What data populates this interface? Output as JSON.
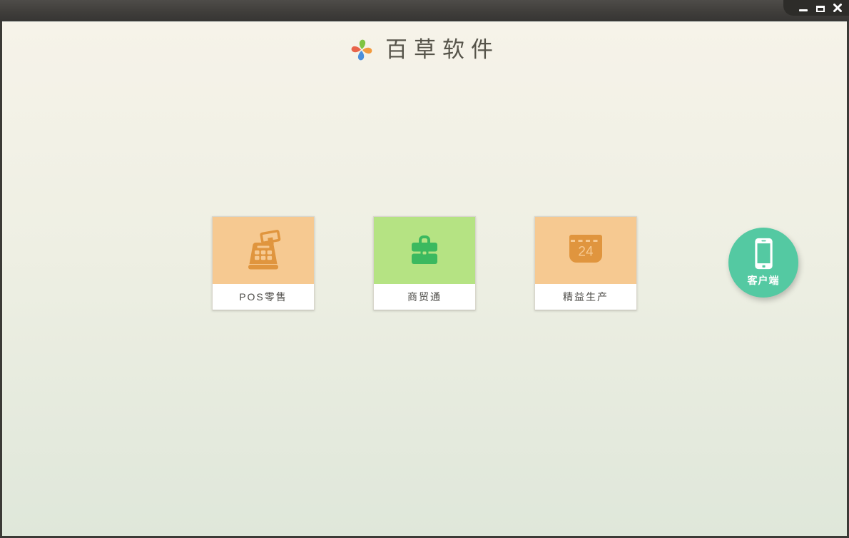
{
  "titlebar": {
    "controls": [
      {
        "name": "minimize"
      },
      {
        "name": "maximize"
      },
      {
        "name": "close"
      }
    ]
  },
  "header": {
    "app_name": "百草软件",
    "logo": "pinwheel-logo"
  },
  "products": [
    {
      "label": "POS零售",
      "icon": "cash-register-icon",
      "tile_color": "#f6c991",
      "icon_color": "#e0953e"
    },
    {
      "label": "商贸通",
      "icon": "briefcase-icon",
      "tile_color": "#b5e383",
      "icon_color": "#3bb95f"
    },
    {
      "label": "精益生产",
      "icon": "calendar-icon",
      "badge": "24",
      "tile_color": "#f6c991",
      "icon_color": "#e0953e"
    }
  ],
  "client_button": {
    "label": "客户端",
    "icon": "smartphone-icon",
    "color": "#54c9a2"
  },
  "colors": {
    "titlebar_top": "#4e4c49",
    "titlebar_bottom": "#363533",
    "frame": "#3b3a36",
    "background_top": "#f6f3e9",
    "background_bottom": "#dfe7da",
    "logo_green": "#7fc440",
    "logo_orange": "#f29a3e",
    "logo_blue": "#4b8fdc",
    "logo_red": "#e8644a",
    "title_text": "#56544a",
    "card_label_text": "#4c4b47"
  }
}
